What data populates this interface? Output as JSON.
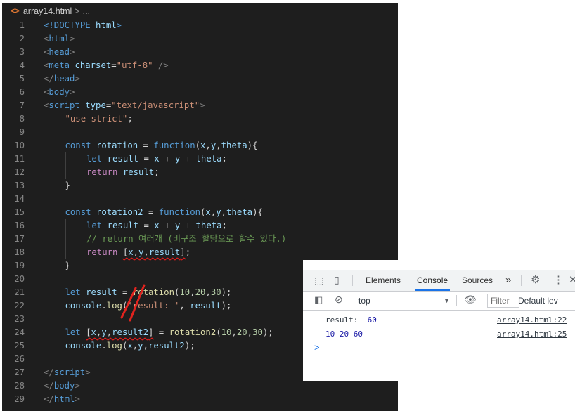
{
  "editor": {
    "breadcrumb": {
      "icon": "<>",
      "file": "array14.html",
      "sep": ">",
      "more": "..."
    },
    "lines": [
      {
        "n": "1",
        "indent": 0,
        "tokens": [
          [
            "t-tag",
            "<!DOCTYPE "
          ],
          [
            "t-attr",
            "html"
          ],
          [
            "t-tag",
            ">"
          ]
        ]
      },
      {
        "n": "2",
        "indent": 0,
        "tokens": [
          [
            "t-punc",
            "<"
          ],
          [
            "t-tag",
            "html"
          ],
          [
            "t-punc",
            ">"
          ]
        ]
      },
      {
        "n": "3",
        "indent": 0,
        "tokens": [
          [
            "t-punc",
            "<"
          ],
          [
            "t-tag",
            "head"
          ],
          [
            "t-punc",
            ">"
          ]
        ]
      },
      {
        "n": "4",
        "indent": 0,
        "tokens": [
          [
            "t-punc",
            "<"
          ],
          [
            "t-tag",
            "meta "
          ],
          [
            "t-attr",
            "charset"
          ],
          [
            "t-txt",
            "="
          ],
          [
            "t-str",
            "\"utf-8\""
          ],
          [
            "t-txt",
            " "
          ],
          [
            "t-punc",
            "/>"
          ]
        ]
      },
      {
        "n": "5",
        "indent": 0,
        "tokens": [
          [
            "t-punc",
            "</"
          ],
          [
            "t-tag",
            "head"
          ],
          [
            "t-punc",
            ">"
          ]
        ]
      },
      {
        "n": "6",
        "indent": 0,
        "tokens": [
          [
            "t-punc",
            "<"
          ],
          [
            "t-tag",
            "body"
          ],
          [
            "t-punc",
            ">"
          ]
        ]
      },
      {
        "n": "7",
        "indent": 0,
        "tokens": [
          [
            "t-punc",
            "<"
          ],
          [
            "t-tag",
            "script "
          ],
          [
            "t-attr",
            "type"
          ],
          [
            "t-txt",
            "="
          ],
          [
            "t-str",
            "\"text/javascript\""
          ],
          [
            "t-punc",
            ">"
          ]
        ]
      },
      {
        "n": "8",
        "indent": 1,
        "tokens": [
          [
            "t-str",
            "\"use strict\""
          ],
          [
            "t-txt",
            ";"
          ]
        ]
      },
      {
        "n": "9",
        "indent": 1,
        "tokens": []
      },
      {
        "n": "10",
        "indent": 1,
        "tokens": [
          [
            "t-kw",
            "const "
          ],
          [
            "t-var",
            "rotation"
          ],
          [
            "t-txt",
            " = "
          ],
          [
            "t-kw",
            "function"
          ],
          [
            "t-txt",
            "("
          ],
          [
            "t-var",
            "x"
          ],
          [
            "t-txt",
            ","
          ],
          [
            "t-var",
            "y"
          ],
          [
            "t-txt",
            ","
          ],
          [
            "t-var",
            "theta"
          ],
          [
            "t-txt",
            "){"
          ]
        ]
      },
      {
        "n": "11",
        "indent": 2,
        "tokens": [
          [
            "t-kw",
            "let "
          ],
          [
            "t-var",
            "result"
          ],
          [
            "t-txt",
            " = "
          ],
          [
            "t-var",
            "x"
          ],
          [
            "t-txt",
            " + "
          ],
          [
            "t-var",
            "y"
          ],
          [
            "t-txt",
            " + "
          ],
          [
            "t-var",
            "theta"
          ],
          [
            "t-txt",
            ";"
          ]
        ]
      },
      {
        "n": "12",
        "indent": 2,
        "tokens": [
          [
            "t-ctrl",
            "return "
          ],
          [
            "t-var",
            "result"
          ],
          [
            "t-txt",
            ";"
          ]
        ]
      },
      {
        "n": "13",
        "indent": 1,
        "tokens": [
          [
            "t-txt",
            "}"
          ]
        ]
      },
      {
        "n": "14",
        "indent": 1,
        "tokens": []
      },
      {
        "n": "15",
        "indent": 1,
        "tokens": [
          [
            "t-kw",
            "const "
          ],
          [
            "t-var",
            "rotation2"
          ],
          [
            "t-txt",
            " = "
          ],
          [
            "t-kw",
            "function"
          ],
          [
            "t-txt",
            "("
          ],
          [
            "t-var",
            "x"
          ],
          [
            "t-txt",
            ","
          ],
          [
            "t-var",
            "y"
          ],
          [
            "t-txt",
            ","
          ],
          [
            "t-var",
            "theta"
          ],
          [
            "t-txt",
            "){"
          ]
        ]
      },
      {
        "n": "16",
        "indent": 2,
        "tokens": [
          [
            "t-kw",
            "let "
          ],
          [
            "t-var",
            "result"
          ],
          [
            "t-txt",
            " = "
          ],
          [
            "t-var",
            "x"
          ],
          [
            "t-txt",
            " + "
          ],
          [
            "t-var",
            "y"
          ],
          [
            "t-txt",
            " + "
          ],
          [
            "t-var",
            "theta"
          ],
          [
            "t-txt",
            ";"
          ]
        ]
      },
      {
        "n": "17",
        "indent": 2,
        "tokens": [
          [
            "t-cmt",
            "// return 여러개 (비구조 할당으로 할수 있다.)"
          ]
        ]
      },
      {
        "n": "18",
        "indent": 2,
        "tokens": [
          [
            "t-ctrl",
            "return "
          ],
          [
            "t-txt squig",
            "["
          ],
          [
            "t-var squig",
            "x"
          ],
          [
            "t-txt squig",
            ","
          ],
          [
            "t-var squig",
            "y"
          ],
          [
            "t-txt squig",
            ","
          ],
          [
            "t-var squig",
            "result"
          ],
          [
            "t-txt squig",
            "]"
          ],
          [
            "t-txt",
            ";"
          ]
        ]
      },
      {
        "n": "19",
        "indent": 1,
        "tokens": [
          [
            "t-txt",
            "}"
          ]
        ]
      },
      {
        "n": "20",
        "indent": 1,
        "tokens": []
      },
      {
        "n": "21",
        "indent": 1,
        "tokens": [
          [
            "t-kw",
            "let "
          ],
          [
            "t-var",
            "result"
          ],
          [
            "t-txt",
            " = "
          ],
          [
            "t-fn",
            "rotation"
          ],
          [
            "t-txt",
            "("
          ],
          [
            "t-num",
            "10"
          ],
          [
            "t-txt",
            ","
          ],
          [
            "t-num",
            "20"
          ],
          [
            "t-txt",
            ","
          ],
          [
            "t-num",
            "30"
          ],
          [
            "t-txt",
            ");"
          ]
        ]
      },
      {
        "n": "22",
        "indent": 1,
        "tokens": [
          [
            "t-var",
            "console"
          ],
          [
            "t-txt",
            "."
          ],
          [
            "t-fn",
            "log"
          ],
          [
            "t-txt",
            "("
          ],
          [
            "t-str",
            "'result: '"
          ],
          [
            "t-txt",
            ", "
          ],
          [
            "t-var",
            "result"
          ],
          [
            "t-txt",
            ");"
          ]
        ]
      },
      {
        "n": "23",
        "indent": 1,
        "tokens": []
      },
      {
        "n": "24",
        "indent": 1,
        "tokens": [
          [
            "t-kw",
            "let "
          ],
          [
            "t-txt squig",
            "["
          ],
          [
            "t-var squig",
            "x"
          ],
          [
            "t-txt squig",
            ","
          ],
          [
            "t-var squig",
            "y"
          ],
          [
            "t-txt squig",
            ","
          ],
          [
            "t-var squig",
            "result2"
          ],
          [
            "t-txt squig",
            "]"
          ],
          [
            "t-txt",
            " = "
          ],
          [
            "t-fn",
            "rotation2"
          ],
          [
            "t-txt",
            "("
          ],
          [
            "t-num",
            "10"
          ],
          [
            "t-txt",
            ","
          ],
          [
            "t-num",
            "20"
          ],
          [
            "t-txt",
            ","
          ],
          [
            "t-num",
            "30"
          ],
          [
            "t-txt",
            ");"
          ]
        ]
      },
      {
        "n": "25",
        "indent": 1,
        "tokens": [
          [
            "t-var",
            "console"
          ],
          [
            "t-txt",
            "."
          ],
          [
            "t-fn",
            "log"
          ],
          [
            "t-txt",
            "("
          ],
          [
            "t-var",
            "x"
          ],
          [
            "t-txt",
            ","
          ],
          [
            "t-var",
            "y"
          ],
          [
            "t-txt",
            ","
          ],
          [
            "t-var",
            "result2"
          ],
          [
            "t-txt",
            ");"
          ]
        ]
      },
      {
        "n": "26",
        "indent": 1,
        "tokens": []
      },
      {
        "n": "27",
        "indent": 0,
        "tokens": [
          [
            "t-punc",
            "</"
          ],
          [
            "t-tag",
            "script"
          ],
          [
            "t-punc",
            ">"
          ]
        ]
      },
      {
        "n": "28",
        "indent": 0,
        "tokens": [
          [
            "t-punc",
            "</"
          ],
          [
            "t-tag",
            "body"
          ],
          [
            "t-punc",
            ">"
          ]
        ]
      },
      {
        "n": "29",
        "indent": 0,
        "tokens": [
          [
            "t-punc",
            "</"
          ],
          [
            "t-tag",
            "html"
          ],
          [
            "t-punc",
            ">"
          ]
        ]
      }
    ]
  },
  "devtools": {
    "tabs": {
      "elements": "Elements",
      "console": "Console",
      "sources": "Sources",
      "more": "»"
    },
    "toolbar": {
      "context": "top",
      "filter_placeholder": "Filter",
      "levels": "Default lev"
    },
    "console_rows": [
      {
        "label": "result:  ",
        "value": "60",
        "source": "array14.html:22"
      },
      {
        "label": "",
        "value": "10 20 60",
        "source": "array14.html:25"
      }
    ],
    "prompt": ">"
  }
}
